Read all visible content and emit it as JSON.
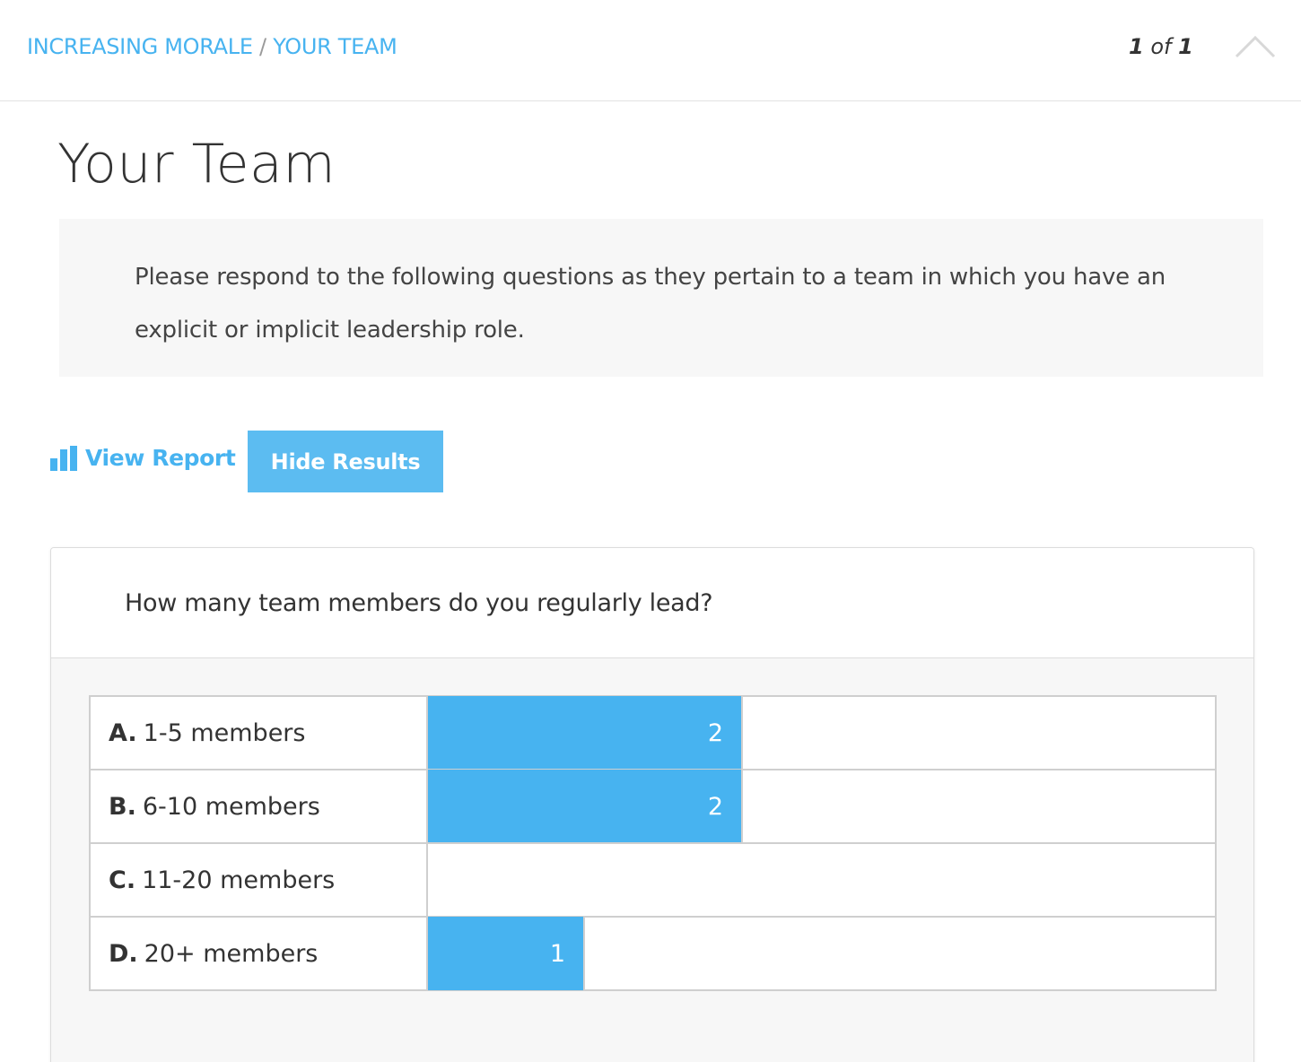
{
  "breadcrumb": {
    "section": "INCREASING MORALE",
    "separator": "/",
    "page": "YOUR TEAM"
  },
  "pager": {
    "current": "1",
    "of_label": "of",
    "total": "1"
  },
  "collapse_icon": "chevron-up-icon",
  "page_title": "Your Team",
  "intro_text": "Please respond to the following questions as they pertain to a team in which you have an explicit or implicit leadership role.",
  "actions": {
    "view_report_label": "View Report",
    "view_report_icon": "bar-chart-icon",
    "hide_results_label": "Hide Results"
  },
  "question": {
    "text": "How many team members do you regularly lead?",
    "options": [
      {
        "letter": "A.",
        "label": "1-5 members",
        "count": 2
      },
      {
        "letter": "B.",
        "label": "6-10 members",
        "count": 2
      },
      {
        "letter": "C.",
        "label": "11-20 members",
        "count": 0
      },
      {
        "letter": "D.",
        "label": "20+ members",
        "count": 1
      }
    ]
  },
  "chart_data": {
    "type": "bar",
    "categories": [
      "A. 1-5 members",
      "B. 6-10 members",
      "C. 11-20 members",
      "D. 20+ members"
    ],
    "values": [
      2,
      2,
      0,
      1
    ],
    "title": "How many team members do you regularly lead?",
    "xlabel": "",
    "ylabel": "",
    "xlim": [
      0,
      5
    ],
    "grid": false
  },
  "colors": {
    "accent": "#47b3f0",
    "button": "#5cbcf1",
    "panel": "#f7f7f7",
    "border": "#cfcfcf"
  }
}
